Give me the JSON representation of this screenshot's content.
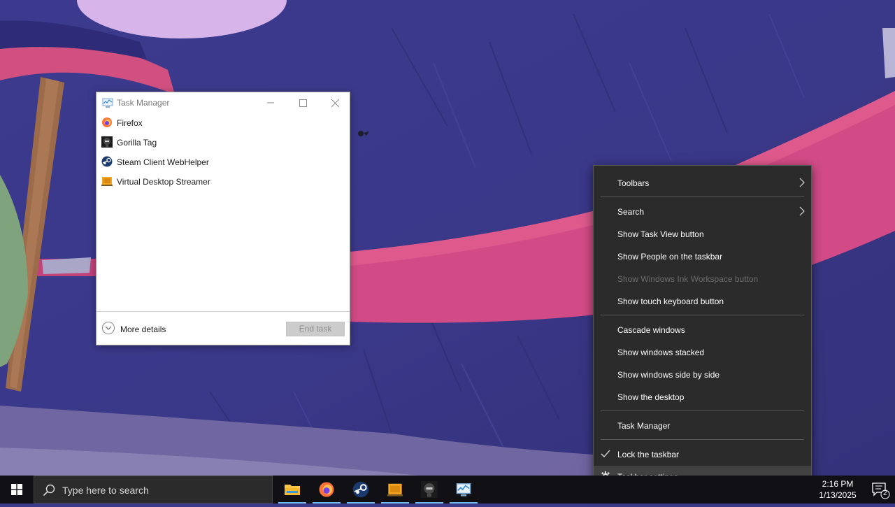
{
  "task_manager": {
    "title": "Task Manager",
    "processes": [
      {
        "name": "Firefox",
        "icon": "firefox-icon"
      },
      {
        "name": "Gorilla Tag",
        "icon": "gorilla-tag-icon"
      },
      {
        "name": "Steam Client WebHelper",
        "icon": "steam-icon"
      },
      {
        "name": "Virtual Desktop Streamer",
        "icon": "virtual-desktop-icon"
      }
    ],
    "more_details": "More details",
    "end_task": "End task"
  },
  "context_menu": {
    "items": [
      {
        "label": "Toolbars",
        "submenu": true
      },
      {
        "label": "Search",
        "submenu": true
      },
      {
        "label": "Show Task View button"
      },
      {
        "label": "Show People on the taskbar"
      },
      {
        "label": "Show Windows Ink Workspace button",
        "disabled": true
      },
      {
        "label": "Show touch keyboard button"
      },
      {
        "label": "Cascade windows"
      },
      {
        "label": "Show windows stacked"
      },
      {
        "label": "Show windows side by side"
      },
      {
        "label": "Show the desktop"
      },
      {
        "label": "Task Manager"
      },
      {
        "label": "Lock the taskbar",
        "checked": true
      },
      {
        "label": "Taskbar settings",
        "icon": "gear-icon",
        "highlighted": true
      }
    ]
  },
  "taskbar": {
    "search_placeholder": "Type here to search",
    "apps": [
      "file-explorer-icon",
      "firefox-icon",
      "steam-icon",
      "virtual-desktop-icon",
      "gorilla-tag-icon",
      "task-manager-icon"
    ],
    "time": "2:16 PM",
    "date": "1/13/2025",
    "notification_count": "2"
  },
  "colors": {
    "menu_bg": "#2b2b2b",
    "taskbar_bg": "#111115",
    "accent": "#76b9ed"
  }
}
